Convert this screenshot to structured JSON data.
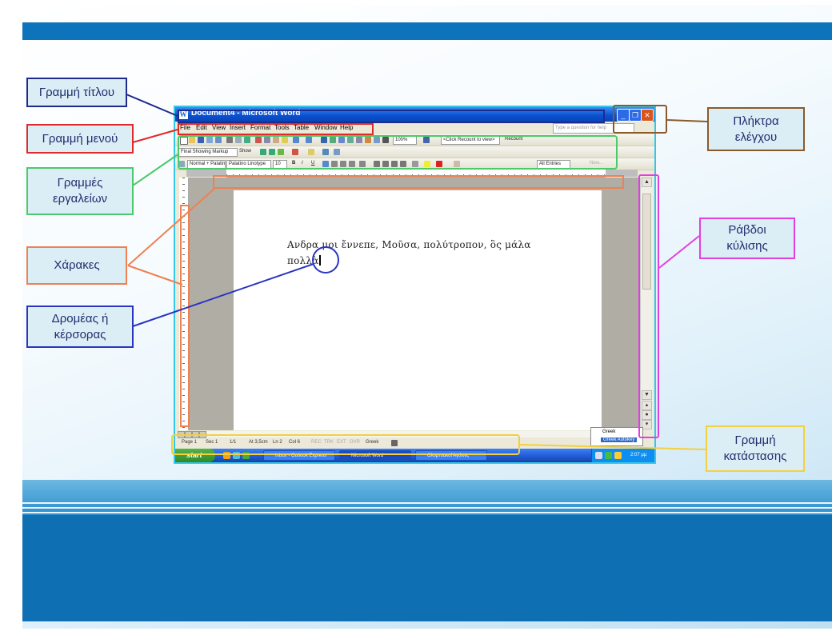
{
  "callouts": {
    "title_bar": "Γραμμή τίτλου",
    "menu_bar": "Γραμμή μενού",
    "toolbars_line1": "Γραμμές",
    "toolbars_line2": "εργαλείων",
    "rulers": "Χάρακες",
    "cursor_line1": "Δρομέας ή",
    "cursor_line2": "κέρσορας",
    "control_buttons_line1": "Πλήκτρα",
    "control_buttons_line2": "ελέγχου",
    "scrollbars_line1": "Ράβδοι",
    "scrollbars_line2": "κύλισης",
    "statusbar_line1": "Γραμμή",
    "statusbar_line2": "κατάστασης"
  },
  "colors": {
    "title_bar": "#1e2a8c",
    "menu_bar": "#e02a2a",
    "toolbars": "#4cc96a",
    "rulers": "#f08050",
    "cursor": "#2a35c0",
    "control_buttons": "#8b5a2b",
    "scrollbars": "#e040e0",
    "status_bar": "#f2d040",
    "screenshot_frame": "#33c8e6",
    "slide_blue": "#0d73ba"
  },
  "word": {
    "title": "Document4 - Microsoft Word",
    "menu": [
      "File",
      "Edit",
      "View",
      "Insert",
      "Format",
      "Tools",
      "Table",
      "Window",
      "Help"
    ],
    "ask_placeholder": "Type a question for help",
    "toolbar1": {
      "zoom": "100%",
      "recount": "<Click Recount to view>",
      "recount_btn": "Recount"
    },
    "toolbar2": {
      "display": "Final Showing Markup",
      "show": "Show"
    },
    "toolbar3": {
      "style": "Normal + Palatin",
      "font": "Palatino Linotype",
      "size": "10",
      "bold": "B",
      "italic": "I",
      "underline": "U",
      "all_entries": "All Entries",
      "new": "New..."
    },
    "document_text_line1": "Ανδρα μοι ἔννεπε, Μοῦσα, πολύτροπον, ὃς μάλα",
    "document_text_line2": "πολλὰ",
    "status": {
      "page": "Page 1",
      "sec": "Sec 1",
      "pages": "1/1",
      "at": "At 3,5cm",
      "ln": "Ln 2",
      "col": "Col 6",
      "rec": "REC",
      "trk": "TRK",
      "ext": "EXT",
      "ovr": "OVR",
      "language": "Greek"
    },
    "language_popup": [
      "Greek",
      "Greek Autokey"
    ],
    "taskbar": {
      "start": "start",
      "tasks": [
        "Inbox - Outlook Express",
        "Microsoft Word",
        "Ολυμπιακοί Αγώνες"
      ],
      "clock": "2:07 μμ"
    }
  }
}
